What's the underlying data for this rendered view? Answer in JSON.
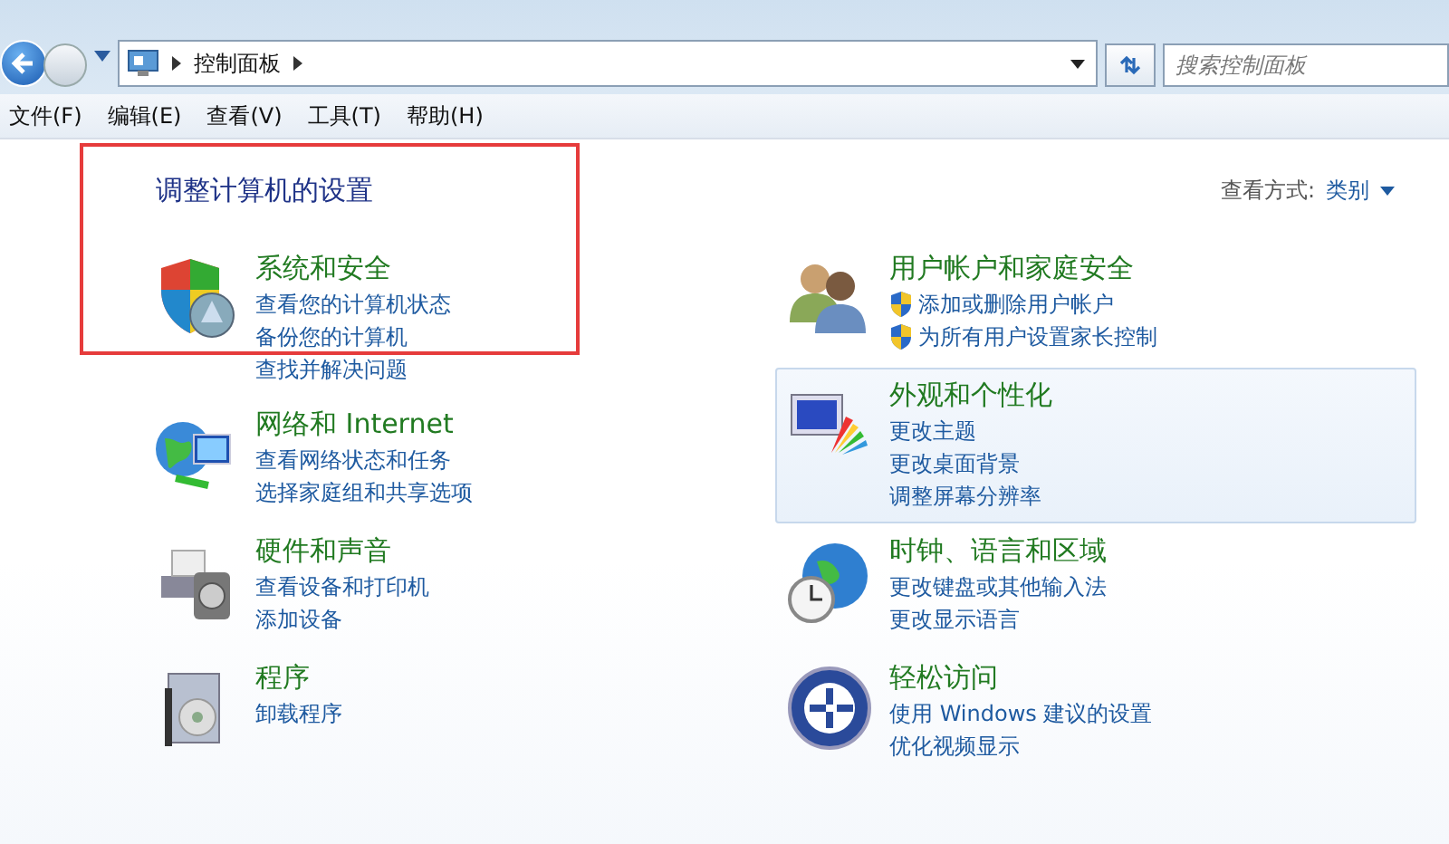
{
  "address_bar": {
    "crumbs": [
      "控制面板"
    ]
  },
  "search": {
    "placeholder": "搜索控制面板"
  },
  "menu": [
    "文件(F)",
    "编辑(E)",
    "查看(V)",
    "工具(T)",
    "帮助(H)"
  ],
  "heading": "调整计算机的设置",
  "view_by": {
    "label": "查看方式:",
    "value": "类别"
  },
  "columns": [
    [
      {
        "title": "系统和安全",
        "highlighted": false,
        "links": [
          {
            "text": "查看您的计算机状态",
            "kind": "plain"
          },
          {
            "text": "备份您的计算机",
            "kind": "plain"
          },
          {
            "text": "查找并解决问题",
            "kind": "plain"
          }
        ]
      },
      {
        "title": "网络和 Internet",
        "highlighted": false,
        "links": [
          {
            "text": "查看网络状态和任务",
            "kind": "plain"
          },
          {
            "text": "选择家庭组和共享选项",
            "kind": "plain"
          }
        ]
      },
      {
        "title": "硬件和声音",
        "highlighted": false,
        "links": [
          {
            "text": "查看设备和打印机",
            "kind": "plain"
          },
          {
            "text": "添加设备",
            "kind": "plain"
          }
        ]
      },
      {
        "title": "程序",
        "highlighted": false,
        "links": [
          {
            "text": "卸载程序",
            "kind": "plain"
          }
        ]
      }
    ],
    [
      {
        "title": "用户帐户和家庭安全",
        "highlighted": false,
        "links": [
          {
            "text": "添加或删除用户帐户",
            "kind": "shield"
          },
          {
            "text": "为所有用户设置家长控制",
            "kind": "shield"
          }
        ]
      },
      {
        "title": "外观和个性化",
        "highlighted": true,
        "links": [
          {
            "text": "更改主题",
            "kind": "plain"
          },
          {
            "text": "更改桌面背景",
            "kind": "plain"
          },
          {
            "text": "调整屏幕分辨率",
            "kind": "plain"
          }
        ]
      },
      {
        "title": "时钟、语言和区域",
        "highlighted": false,
        "links": [
          {
            "text": "更改键盘或其他输入法",
            "kind": "plain"
          },
          {
            "text": "更改显示语言",
            "kind": "plain"
          }
        ]
      },
      {
        "title": "轻松访问",
        "highlighted": false,
        "links": [
          {
            "text": "使用 Windows 建议的设置",
            "kind": "plain"
          },
          {
            "text": "优化视频显示",
            "kind": "plain"
          }
        ]
      }
    ]
  ]
}
